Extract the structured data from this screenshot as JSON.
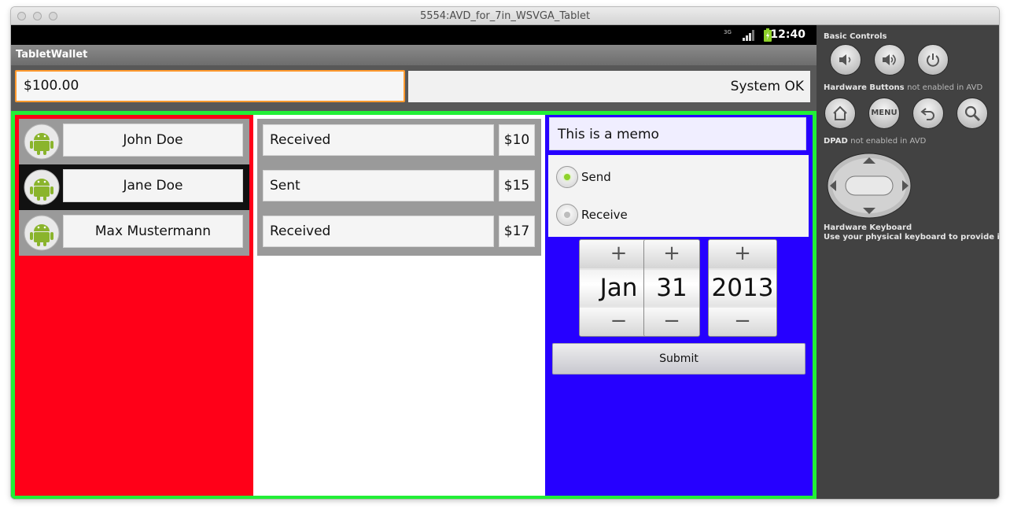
{
  "window": {
    "title": "5554:AVD_for_7in_WSVGA_Tablet"
  },
  "statusbar": {
    "time": "12:40",
    "network": "3G"
  },
  "app": {
    "title": "TabletWallet",
    "balance": "$100.00",
    "status": "System OK"
  },
  "contacts": [
    {
      "name": "John Doe",
      "selected": false
    },
    {
      "name": "Jane Doe",
      "selected": true
    },
    {
      "name": "Max Mustermann",
      "selected": false
    }
  ],
  "transactions": [
    {
      "type": "Received",
      "amount": "$10"
    },
    {
      "type": "Sent",
      "amount": "$15"
    },
    {
      "type": "Received",
      "amount": "$17"
    }
  ],
  "form": {
    "memo": "This is a memo",
    "radios": [
      {
        "label": "Send",
        "checked": true
      },
      {
        "label": "Receive",
        "checked": false
      }
    ],
    "date": {
      "month": "Jan",
      "day": "31",
      "year": "2013",
      "increment": "+",
      "decrement": "−"
    },
    "submit_label": "Submit"
  },
  "controls": {
    "basic_label": "Basic Controls",
    "hw_label": "Hardware Buttons",
    "hw_note": "not enabled in AVD",
    "menu_label": "MENU",
    "dpad_label": "DPAD",
    "dpad_note": "not enabled in AVD",
    "keyboard_label": "Hardware Keyboard",
    "keyboard_note": "Use your physical keyboard to provide input"
  },
  "colors": {
    "outer_frame": "#21ef36",
    "left_column": "#ff0018",
    "right_column": "#2600ff",
    "focus": "#ff9a2e"
  }
}
